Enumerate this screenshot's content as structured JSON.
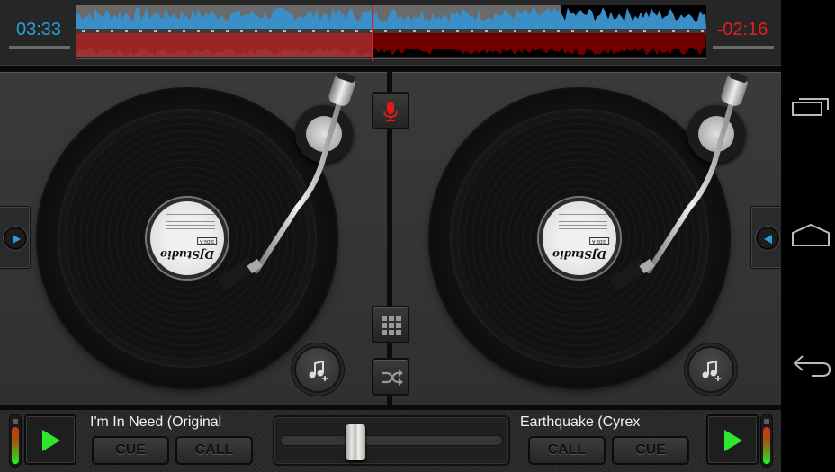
{
  "app": {
    "name": "DJ Studio"
  },
  "topbar": {
    "time_left": "03:33",
    "time_right": "-02:16",
    "deck_a_progress": 0.47,
    "deck_b_progress": 0.77
  },
  "colors": {
    "deck_a": "#2a9fd6",
    "deck_b": "#e02020",
    "wave_blue": "#3a8fc8",
    "wave_red": "#a32a2a",
    "wave_dark_red": "#6e0000",
    "play_green": "#2ee62e",
    "gear_blue": "#1e8fb8"
  },
  "decks": {
    "left": {
      "record_label": "DJStudio",
      "record_side": "SIDE A",
      "track_title": "I'm In Need (Original",
      "cue_label": "CUE",
      "call_label": "CALL",
      "vu_level": 0.85,
      "side_arrow": "play-right"
    },
    "right": {
      "record_label": "DJStudio",
      "record_side": "SIDE A",
      "track_title": "Earthquake (Cyrex",
      "cue_label": "CUE",
      "call_label": "CALL",
      "vu_level": 0.85,
      "side_arrow": "play-left"
    }
  },
  "center": {
    "mic_icon": "microphone-icon",
    "grid_icon": "grid-icon",
    "shuffle_icon": "shuffle-icon"
  },
  "crossfader": {
    "position": 0.33
  },
  "icons": {
    "settings": "gears-icon",
    "add_music": "music-add-icon"
  },
  "navbar": {
    "recents": "recent-apps-icon",
    "home": "home-icon",
    "back": "back-icon"
  }
}
